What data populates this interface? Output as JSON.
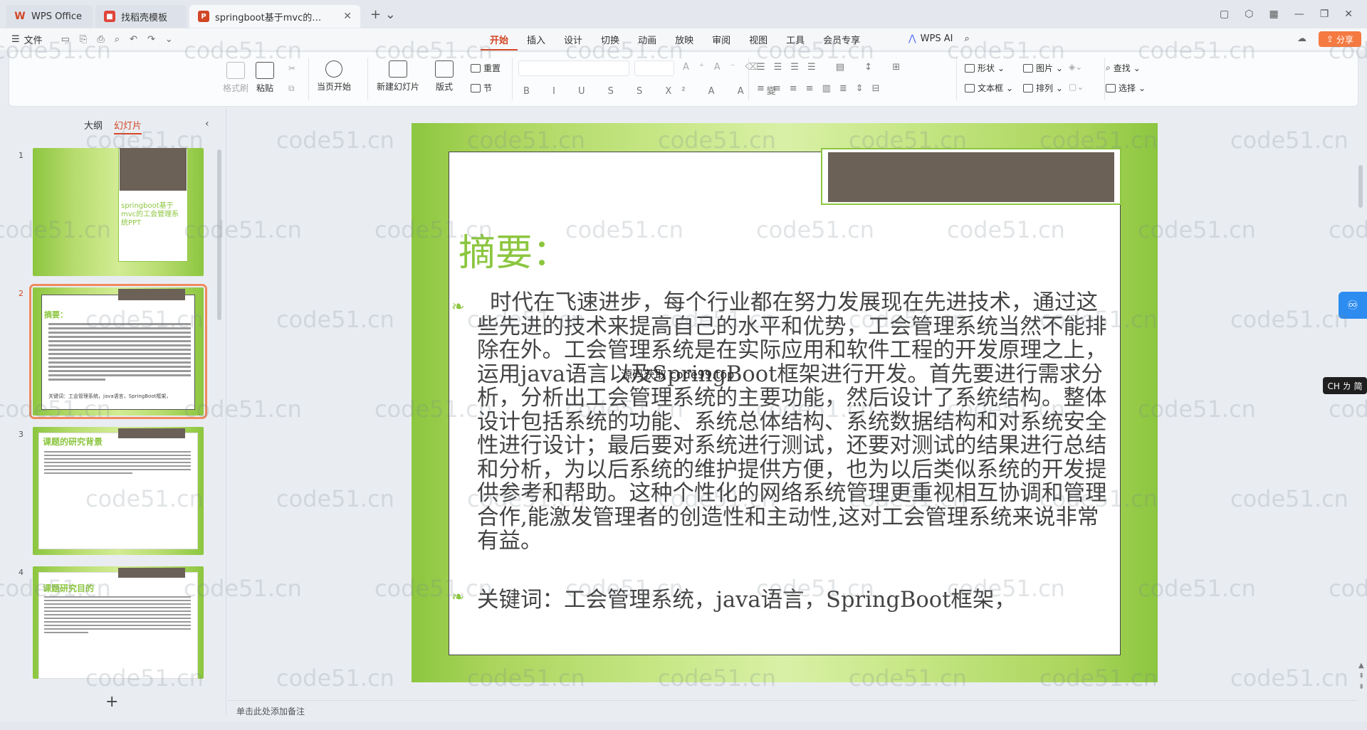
{
  "tabs": [
    {
      "label": "WPS Office"
    },
    {
      "label": "找稻壳模板"
    },
    {
      "label": "springboot基于mvc的工会管理系统PPT"
    }
  ],
  "menubar": {
    "file_label": "文件",
    "menus": [
      "开始",
      "插入",
      "设计",
      "切换",
      "动画",
      "放映",
      "审阅",
      "视图",
      "工具",
      "会员专享"
    ],
    "active_menu": "开始",
    "wps_ai": "WPS AI",
    "share": "分享"
  },
  "ribbon": {
    "format_painter": "格式刷",
    "paste": "粘贴",
    "start_from_current": "当页开始",
    "new_slide": "新建幻灯片",
    "layout": "版式",
    "reset": "重置",
    "section": "节",
    "shape": "形状",
    "picture": "图片",
    "textbox": "文本框",
    "arrange": "排列",
    "find": "查找",
    "select": "选择"
  },
  "left_panel": {
    "tab_outline": "大纲",
    "tab_slides": "幻灯片",
    "thumbnails": [
      {
        "num": "1",
        "title": "springboot基于mvc的工会管理系统PPT"
      },
      {
        "num": "2",
        "title": "摘要：",
        "footer": "关键词：工会管理系统，java语言，SpringBoot框架，"
      },
      {
        "num": "3",
        "title": "课题的研究背景"
      },
      {
        "num": "4",
        "title": "课题研究目的"
      }
    ],
    "add_slide": "+"
  },
  "slide": {
    "title": "摘要：",
    "body": "时代在飞速进步，每个行业都在努力发展现在先进技术，通过这些先进的技术来提高自己的水平和优势，工会管理系统当然不能排除在外。工会管理系统是在实际应用和软件工程的开发原理之上，运用java语言以及SpringBoot框架进行开发。首先要进行需求分析，分析出工会管理系统的主要功能，然后设计了系统结构。整体设计包括系统的功能、系统总体结构、系统数据结构和对系统安全性进行设计；最后要对系统进行测试，还要对测试的结果进行总结和分析，为以后系统的维护提供方便，也为以后类似系统的开发提供参考和帮助。这种个性化的网络系统管理更重视相互协调和管理合作,能激发管理者的创造性和主动性,这对工会管理系统来说非常有益。",
    "keywords": "关键词：工会管理系统，java语言，SpringBoot框架，",
    "overlay": "源码获取 code99.top"
  },
  "notes": {
    "placeholder": "单击此处添加备注"
  },
  "ime": "CH ㄌ 简",
  "watermark": "code51.cn",
  "colors": {
    "accent": "#d24726",
    "slide_green": "#8cc63f",
    "slide_tab": "#6b6157",
    "share": "#f47a42"
  }
}
